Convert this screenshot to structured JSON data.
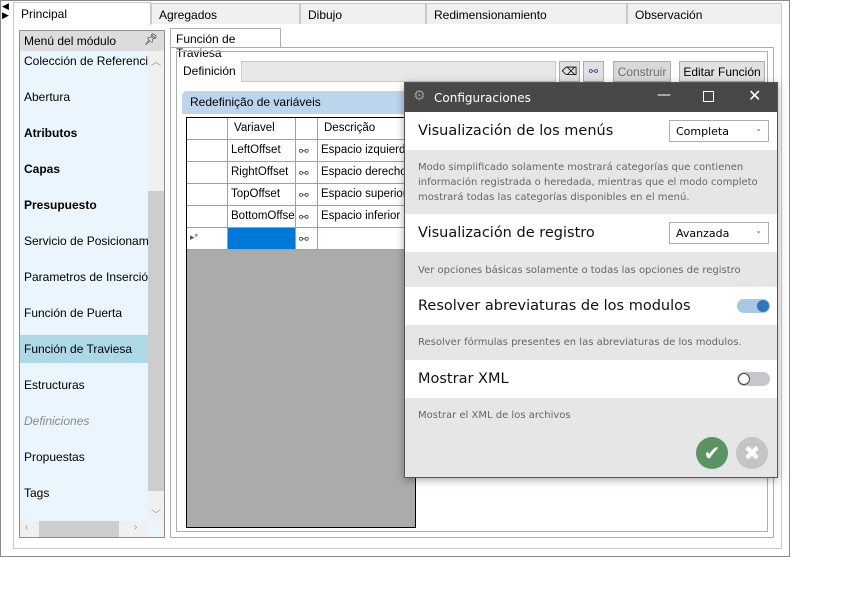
{
  "tabs": [
    "Principal",
    "Agregados",
    "Dibujo",
    "Redimensionamiento",
    "Observación"
  ],
  "sidebar": {
    "title": "Menú del módulo",
    "items": [
      {
        "label": "Colección de Referencias",
        "style": "normal"
      },
      {
        "label": "Abertura",
        "style": "normal"
      },
      {
        "label": "Atributos",
        "style": "bold"
      },
      {
        "label": "Capas",
        "style": "bold"
      },
      {
        "label": "Presupuesto",
        "style": "bold"
      },
      {
        "label": "Servicio de Posicionamiento",
        "style": "normal"
      },
      {
        "label": "Parametros de Inserción",
        "style": "normal"
      },
      {
        "label": "Función de Puerta",
        "style": "normal"
      },
      {
        "label": "Función de Traviesa",
        "style": "selected"
      },
      {
        "label": "Estructuras",
        "style": "normal"
      },
      {
        "label": "Definiciones",
        "style": "italic"
      },
      {
        "label": "Propuestas",
        "style": "normal"
      },
      {
        "label": "Tags",
        "style": "normal"
      }
    ]
  },
  "editor": {
    "tab": "Función de Traviesa",
    "definition_label": "Definición",
    "definition_value": "",
    "build_button": "Construir",
    "edit_button": "Editar Función",
    "group_title": "Redefinição de variáveis",
    "columns": [
      "Variavel",
      "Descrição"
    ],
    "rows": [
      {
        "var": "LeftOffset",
        "desc": "Espacio izquierdo"
      },
      {
        "var": "RightOffset",
        "desc": "Espacio derecho de"
      },
      {
        "var": "TopOffset",
        "desc": "Espacio superior de"
      },
      {
        "var": "BottomOffset",
        "desc": "Espacio inferior de"
      }
    ],
    "new_row_marker": "▸*"
  },
  "dialog": {
    "title": "Configuraciones",
    "menu_view": {
      "label": "Visualización de los menús",
      "value": "Completa",
      "desc": "Modo simplificado solamente mostrará categorías que contienen información registrada o heredada, mientras que el modo completo mostrará todas las categorías disponibles en el menú."
    },
    "log_view": {
      "label": "Visualización de registro",
      "value": "Avanzada",
      "desc": "Ver opciones básicas solamente o todas las opciones de registro"
    },
    "resolve": {
      "label": "Resolver abreviaturas de los modulos",
      "on": true,
      "desc": "Resolver fórmulas presentes en las abreviaturas de los modulos."
    },
    "xml": {
      "label": "Mostrar XML",
      "on": false,
      "desc": "Mostrar el XML de los archivos"
    },
    "colors": {
      "accept": "#5b9362",
      "cancel": "#c4c4c4",
      "toggle_on": "#2f75bb"
    }
  }
}
